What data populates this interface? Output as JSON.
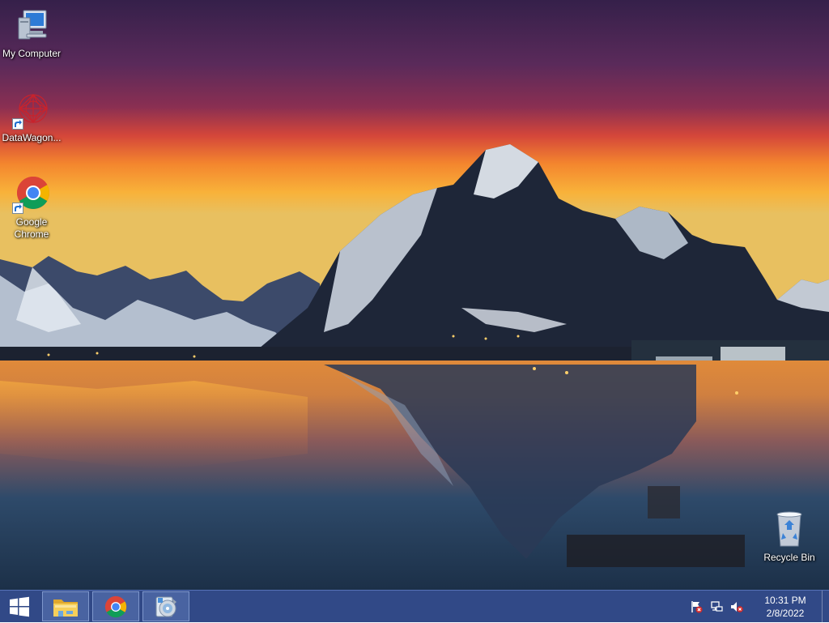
{
  "desktop": {
    "icons": [
      {
        "label": "My Computer",
        "icon": "computer-icon",
        "shortcut": false
      },
      {
        "label": "DataWagon...",
        "icon": "datawagon-icon",
        "shortcut": true
      },
      {
        "label": "Google Chrome",
        "icon": "chrome-icon",
        "shortcut": true
      },
      {
        "label": "Recycle Bin",
        "icon": "recycle-bin-icon",
        "shortcut": false
      }
    ]
  },
  "taskbar": {
    "start_icon": "windows-logo-icon",
    "pinned": [
      {
        "name": "File Explorer",
        "icon": "folder-icon"
      },
      {
        "name": "Google Chrome",
        "icon": "chrome-icon"
      },
      {
        "name": "Disc Utility",
        "icon": "disc-utility-icon"
      }
    ],
    "tray": {
      "icons": [
        "action-center-flag-icon",
        "network-icon",
        "volume-muted-icon"
      ],
      "time": "10:31 PM",
      "date": "2/8/2022"
    }
  },
  "colors": {
    "taskbar": "#1f3a7d",
    "sky_top": "#3a1f4f",
    "sunset": "#f07a2a",
    "water": "#2a4a6a"
  }
}
